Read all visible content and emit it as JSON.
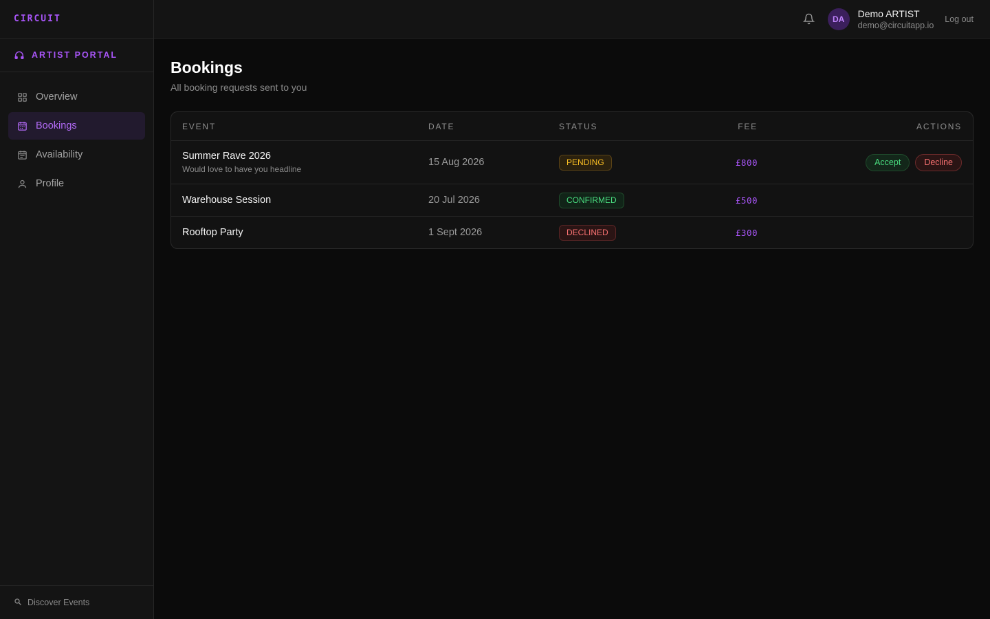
{
  "brand": {
    "logo": "CIRCUIT"
  },
  "sidebar": {
    "portal_label": "ARTIST PORTAL",
    "items": [
      {
        "label": "Overview",
        "icon": "grid-icon",
        "active": false
      },
      {
        "label": "Bookings",
        "icon": "calendar-icon",
        "active": true
      },
      {
        "label": "Availability",
        "icon": "calendar-check-icon",
        "active": false
      },
      {
        "label": "Profile",
        "icon": "user-icon",
        "active": false
      }
    ],
    "footer_label": "Discover Events"
  },
  "header": {
    "avatar_initials": "DA",
    "user_name": "Demo ARTIST",
    "user_email": "demo@circuitapp.io",
    "logout_label": "Log out"
  },
  "page": {
    "title": "Bookings",
    "subtitle": "All booking requests sent to you"
  },
  "table": {
    "columns": {
      "event": "EVENT",
      "date": "DATE",
      "status": "STATUS",
      "fee": "FEE",
      "actions": "ACTIONS"
    },
    "rows": [
      {
        "event": "Summer Rave 2026",
        "note": "Would love to have you headline",
        "date": "15 Aug 2026",
        "status": "PENDING",
        "fee": "£800",
        "accept_label": "Accept",
        "decline_label": "Decline"
      },
      {
        "event": "Warehouse Session",
        "date": "20 Jul 2026",
        "status": "CONFIRMED",
        "fee": "£500"
      },
      {
        "event": "Rooftop Party",
        "date": "1 Sept 2026",
        "status": "DECLINED",
        "fee": "£300"
      }
    ]
  },
  "colors": {
    "accent": "#a855f7",
    "pending": "#fbbf24",
    "confirmed": "#4ade80",
    "declined": "#f87171",
    "background": "#0b0b0b",
    "panel": "#141414"
  }
}
